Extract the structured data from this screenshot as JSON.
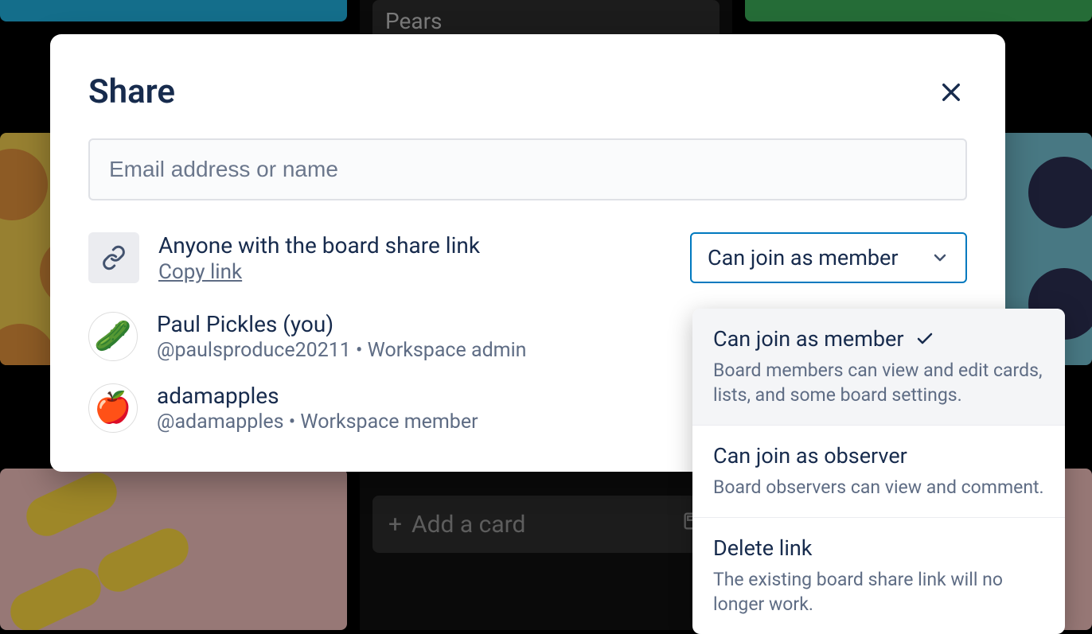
{
  "background": {
    "card_title": "Pears",
    "add_card_label": "Add a card"
  },
  "modal": {
    "title": "Share",
    "email_placeholder": "Email address or name",
    "link_row": {
      "heading": "Anyone with the board share link",
      "copy_link": "Copy link"
    },
    "permission_selected": "Can join as member",
    "members": [
      {
        "name": "Paul Pickles (you)",
        "meta": "@paulsproduce20211 • Workspace admin",
        "avatar_bg": "#ffffff",
        "avatar_emoji": "🥒"
      },
      {
        "name": "adamapples",
        "meta": "@adamapples • Workspace member",
        "avatar_bg": "#ffffff",
        "avatar_emoji": "🍎"
      }
    ]
  },
  "dropdown": {
    "options": [
      {
        "title": "Can join as member",
        "desc": "Board members can view and edit cards, lists, and some board settings.",
        "selected": true
      },
      {
        "title": "Can join as observer",
        "desc": "Board observers can view and comment.",
        "selected": false
      },
      {
        "title": "Delete link",
        "desc": "The existing board share link will no longer work.",
        "selected": false
      }
    ]
  }
}
